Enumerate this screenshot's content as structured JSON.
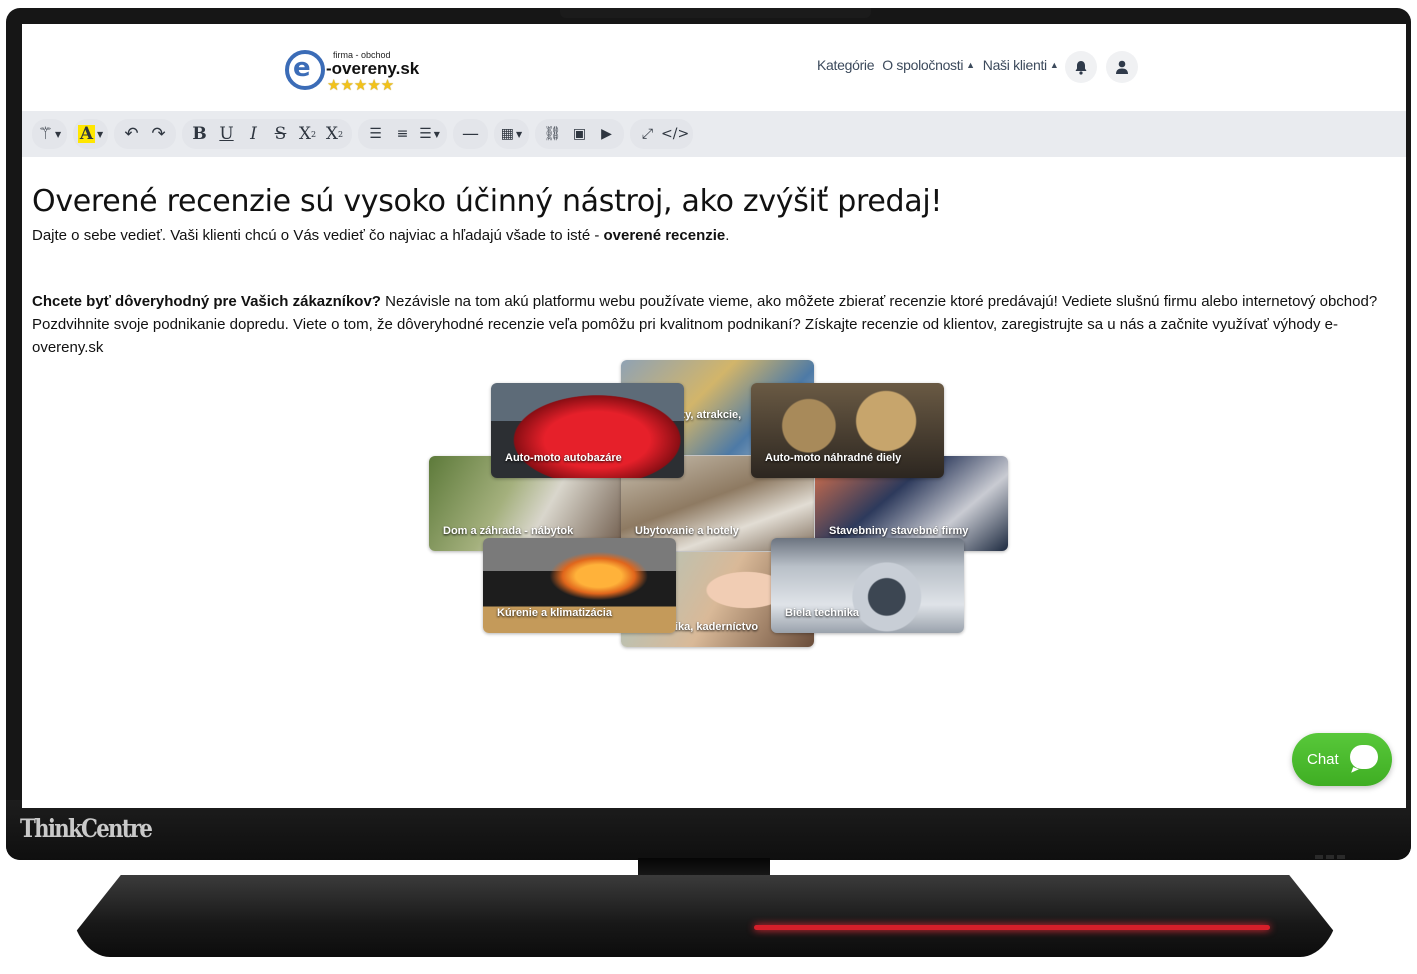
{
  "header": {
    "logo": {
      "tagline": "firma - obchod",
      "name": "e-overeny.sk",
      "stars": "★★★★★"
    },
    "nav": [
      {
        "label": "Kategórie",
        "has_caret": false
      },
      {
        "label": "O spoločnosti",
        "has_caret": true
      },
      {
        "label": "Naši klienti",
        "has_caret": true
      }
    ],
    "icons": [
      "bell-icon",
      "user-icon"
    ]
  },
  "toolbar": {
    "groups": [
      [
        "magic-wand-icon"
      ],
      [
        "highlight-color-icon"
      ],
      [
        "undo-icon",
        "redo-icon"
      ],
      [
        "bold-icon",
        "underline-icon",
        "italic-icon",
        "strikethrough-icon",
        "subscript-icon",
        "superscript-icon"
      ],
      [
        "unordered-list-icon",
        "ordered-list-icon",
        "align-icon"
      ],
      [
        "horizontal-rule-icon"
      ],
      [
        "table-icon"
      ],
      [
        "link-icon",
        "image-icon",
        "video-icon"
      ],
      [
        "fullscreen-icon",
        "code-view-icon"
      ]
    ],
    "highlight_color": "#ffe600"
  },
  "content": {
    "headline": "Overené recenzie sú vysoko účinný nástroj, ako zvýšiť predaj!",
    "intro_text": "Dajte o sebe vedieť. Vaši klienti chcú o Vás vedieť čo najviac a hľadajú všade to isté - ",
    "intro_bold": "overené recenzie",
    "intro_end": ".",
    "body_bold": "Chcete byť dôveryhodný pre Vašich zákazníkov?",
    "body_text": " Nezávisle na tom akú platformu webu používate vieme, ako môžete zbierať recenzie ktoré predávajú! Vediete slušnú firmu alebo internetový obchod? Pozdvihnite svoje podnikanie dopredu. Viete o tom, že dôveryhodné recenzie veľa pomôžu pri kvalitnom podnikaní? Získajte recenzie od klientov, zaregistrujte sa u nás a začnite využívať výhody e-overeny.sk"
  },
  "categories": [
    {
      "id": "gallery",
      "label": "ky, atrakcie,"
    },
    {
      "id": "car",
      "label": "Auto-moto autobazáre"
    },
    {
      "id": "gears",
      "label": "Auto-moto náhradné diely"
    },
    {
      "id": "garden",
      "label": "Dom a záhrada - nábytok"
    },
    {
      "id": "hotel",
      "label": "Ubytovanie a hotely"
    },
    {
      "id": "build",
      "label": "Stavebniny stavebné firmy"
    },
    {
      "id": "beauty",
      "label": "ika, kaderníctvo"
    },
    {
      "id": "fire",
      "label": "Kúrenie a klimatizácia"
    },
    {
      "id": "white",
      "label": "Biela technika"
    }
  ],
  "chat": {
    "label": "Chat",
    "color": "#4cbb2e"
  },
  "device": {
    "brand": "ThinkCentre"
  }
}
